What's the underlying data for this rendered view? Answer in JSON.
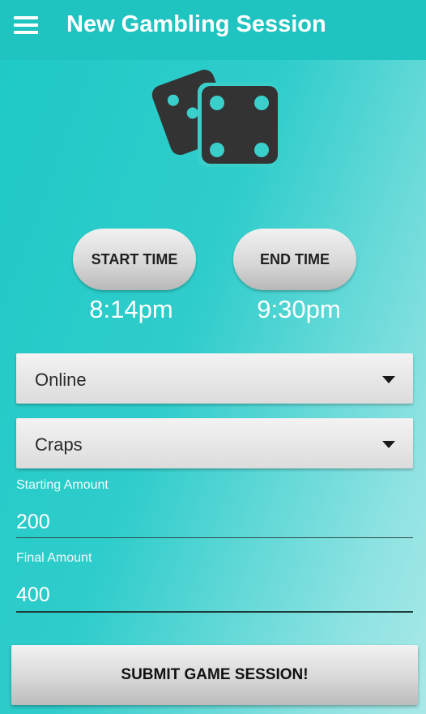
{
  "appbar": {
    "title": "New Gambling Session",
    "menu_icon": "hamburger-menu-icon"
  },
  "hero": {
    "icon": "dice-icon"
  },
  "times": {
    "start_label": "START TIME",
    "start_value": "8:14pm",
    "end_label": "END TIME",
    "end_value": "9:30pm"
  },
  "selects": {
    "location": "Online",
    "game": "Craps"
  },
  "fields": {
    "starting_label": "Starting Amount",
    "starting_value": "200",
    "final_label": "Final Amount",
    "final_value": "400"
  },
  "submit_label": "SUBMIT GAME SESSION!",
  "colors": {
    "appbar": "#1fc3c0",
    "background_start": "#1ec9c6",
    "background_end": "#a9e9e8",
    "dice": "#333333"
  }
}
